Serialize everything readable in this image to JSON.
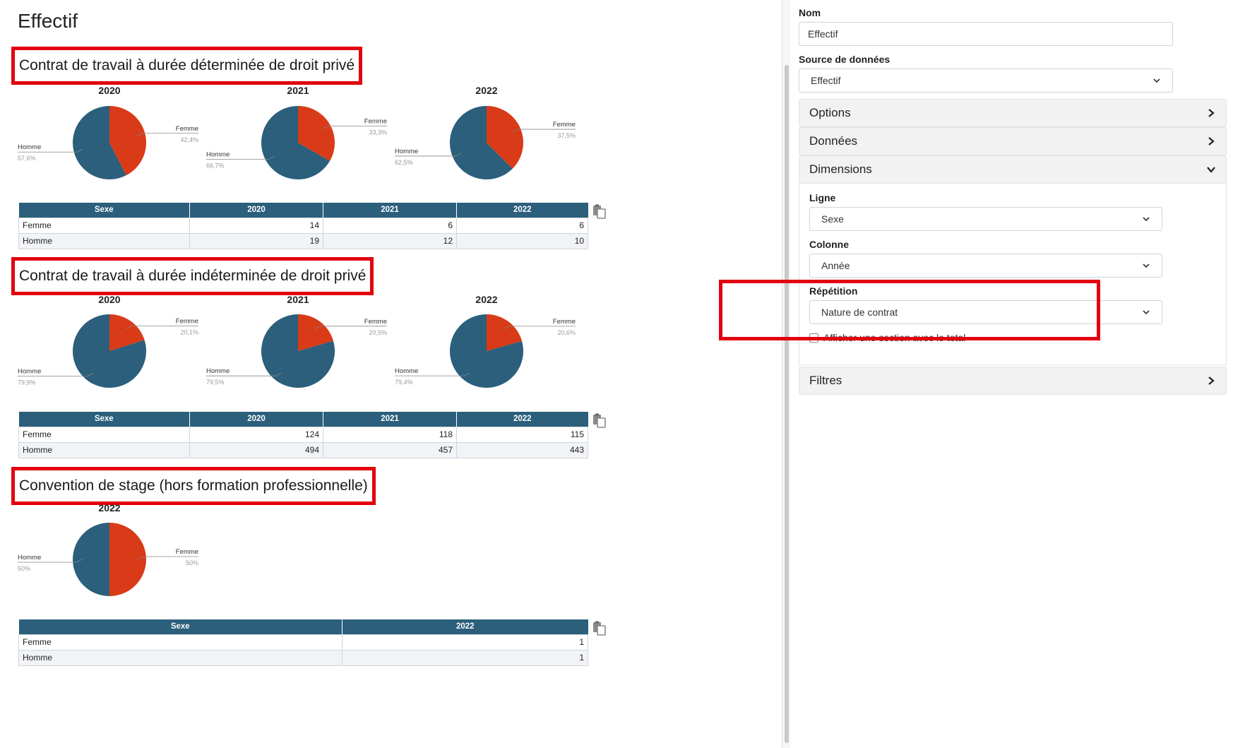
{
  "page": {
    "title": "Effectif"
  },
  "report": {
    "sections": [
      {
        "title": "Contrat de travail à durée déterminée de droit privé",
        "charts": [
          {
            "year": "2020",
            "femme_label": "Femme",
            "femme_pct": "42,4%",
            "homme_label": "Homme",
            "homme_pct": "57,6%",
            "femme_share": 0.424
          },
          {
            "year": "2021",
            "femme_label": "Femme",
            "femme_pct": "33,3%",
            "homme_label": "Homme",
            "homme_pct": "66,7%",
            "femme_share": 0.333
          },
          {
            "year": "2022",
            "femme_label": "Femme",
            "femme_pct": "37,5%",
            "homme_label": "Homme",
            "homme_pct": "62,5%",
            "femme_share": 0.375
          }
        ],
        "table": {
          "headers": [
            "Sexe",
            "2020",
            "2021",
            "2022"
          ],
          "rows": [
            [
              "Femme",
              "14",
              "6",
              "6"
            ],
            [
              "Homme",
              "19",
              "12",
              "10"
            ]
          ]
        }
      },
      {
        "title": "Contrat de travail à durée indéterminée de droit privé",
        "charts": [
          {
            "year": "2020",
            "femme_label": "Femme",
            "femme_pct": "20,1%",
            "homme_label": "Homme",
            "homme_pct": "79,9%",
            "femme_share": 0.201
          },
          {
            "year": "2021",
            "femme_label": "Femme",
            "femme_pct": "20,5%",
            "homme_label": "Homme",
            "homme_pct": "79,5%",
            "femme_share": 0.205
          },
          {
            "year": "2022",
            "femme_label": "Femme",
            "femme_pct": "20,6%",
            "homme_label": "Homme",
            "homme_pct": "79,4%",
            "femme_share": 0.206
          }
        ],
        "table": {
          "headers": [
            "Sexe",
            "2020",
            "2021",
            "2022"
          ],
          "rows": [
            [
              "Femme",
              "124",
              "118",
              "115"
            ],
            [
              "Homme",
              "494",
              "457",
              "443"
            ]
          ]
        }
      },
      {
        "title": "Convention de stage (hors formation professionnelle)",
        "charts": [
          {
            "year": "2022",
            "femme_label": "Femme",
            "femme_pct": "50%",
            "homme_label": "Homme",
            "homme_pct": "50%",
            "femme_share": 0.5
          }
        ],
        "table": {
          "headers": [
            "Sexe",
            "2022"
          ],
          "rows": [
            [
              "Femme",
              "1"
            ],
            [
              "Homme",
              "1"
            ]
          ]
        }
      }
    ]
  },
  "colors": {
    "femme": "#d93a17",
    "homme": "#2b5f7b",
    "highlight": "#e3000f",
    "header_bg": "#2b5f7b"
  },
  "panel": {
    "nom_label": "Nom",
    "nom_value": "Effectif",
    "source_label": "Source de données",
    "source_value": "Effectif",
    "accordions": {
      "options": "Options",
      "donnees": "Données",
      "dimensions": "Dimensions",
      "filtres": "Filtres"
    },
    "dimensions": {
      "ligne_label": "Ligne",
      "ligne_value": "Sexe",
      "colonne_label": "Colonne",
      "colonne_value": "Année",
      "repetition_label": "Répétition",
      "repetition_value": "Nature de contrat",
      "total_checkbox_label": "Afficher une section avec le total"
    }
  },
  "chart_data": [
    {
      "type": "pie",
      "title": "2020",
      "labels": [
        "Femme",
        "Homme"
      ],
      "values": [
        42.4,
        57.6
      ]
    },
    {
      "type": "pie",
      "title": "2021",
      "labels": [
        "Femme",
        "Homme"
      ],
      "values": [
        33.3,
        66.7
      ]
    },
    {
      "type": "pie",
      "title": "2022",
      "labels": [
        "Femme",
        "Homme"
      ],
      "values": [
        37.5,
        62.5
      ]
    },
    {
      "type": "pie",
      "title": "2020",
      "labels": [
        "Femme",
        "Homme"
      ],
      "values": [
        20.1,
        79.9
      ]
    },
    {
      "type": "pie",
      "title": "2021",
      "labels": [
        "Femme",
        "Homme"
      ],
      "values": [
        20.5,
        79.5
      ]
    },
    {
      "type": "pie",
      "title": "2022",
      "labels": [
        "Femme",
        "Homme"
      ],
      "values": [
        20.6,
        79.4
      ]
    },
    {
      "type": "pie",
      "title": "2022",
      "labels": [
        "Femme",
        "Homme"
      ],
      "values": [
        50,
        50
      ]
    }
  ]
}
